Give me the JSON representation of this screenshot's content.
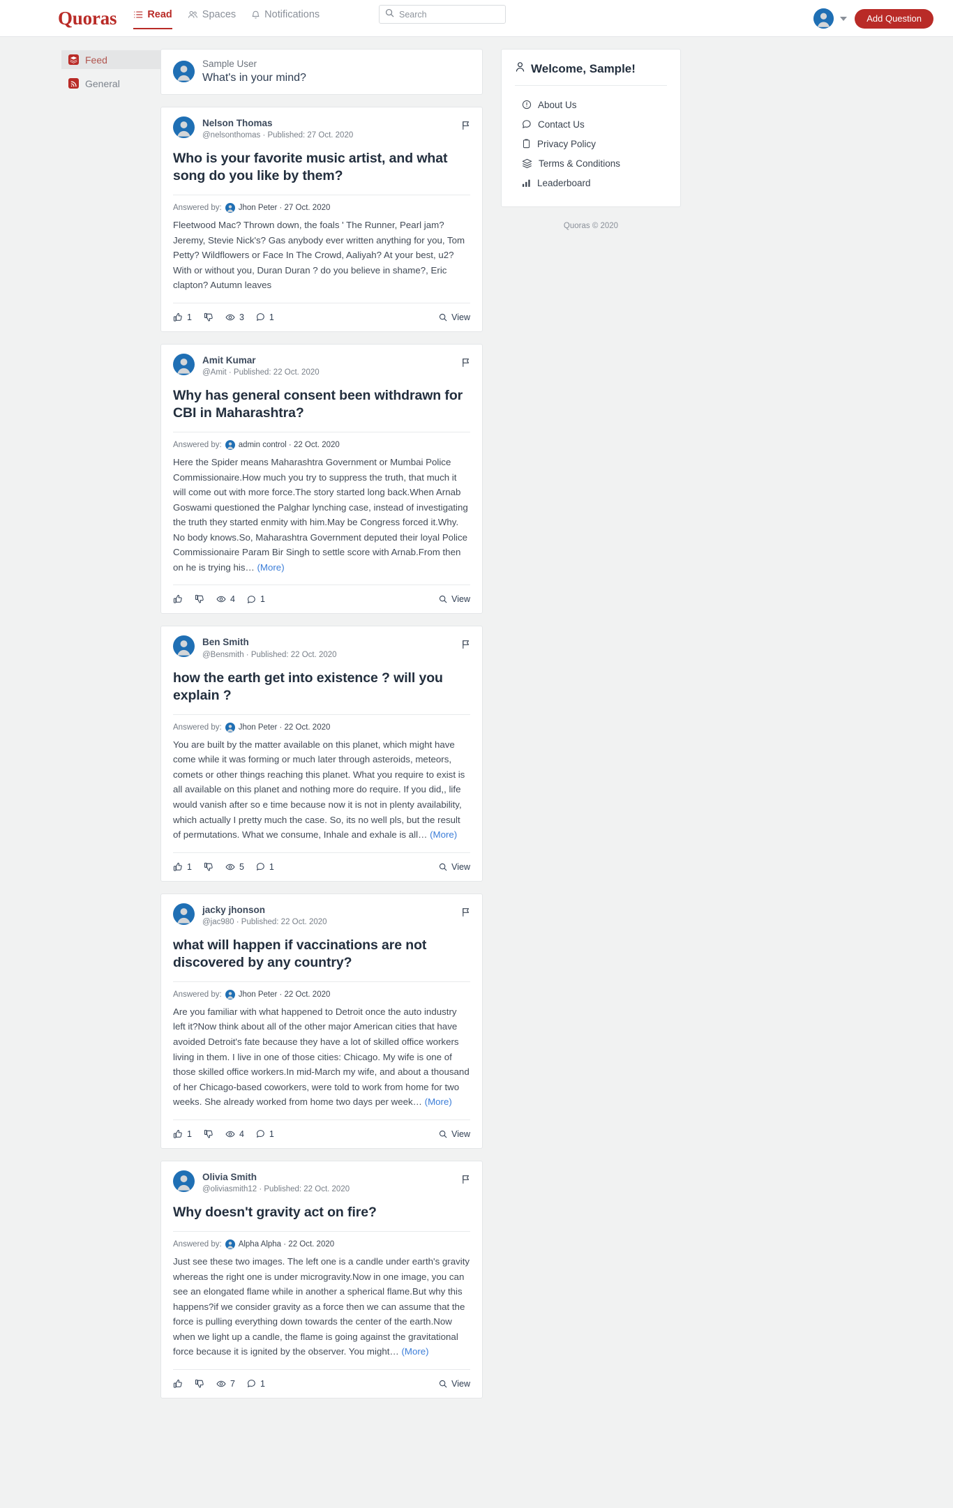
{
  "header": {
    "brand": "Quoras",
    "nav": [
      {
        "label": "Read",
        "icon": "list-icon",
        "active": true
      },
      {
        "label": "Spaces",
        "icon": "people-icon",
        "active": false
      },
      {
        "label": "Notifications",
        "icon": "bell-icon",
        "active": false
      }
    ],
    "search_placeholder": "Search",
    "search_value": "",
    "add_question_label": "Add Question",
    "accent_color": "#b92b27",
    "avatar_color": "#1f6fb4"
  },
  "sidebar": {
    "items": [
      {
        "label": "Feed",
        "icon": "layers-icon",
        "active": true
      },
      {
        "label": "General",
        "icon": "rss-icon",
        "active": false
      }
    ]
  },
  "composer": {
    "user": "Sample User",
    "prompt": "What's in your mind?"
  },
  "posts": [
    {
      "author": "Nelson Thomas",
      "handle": "@nelsonthomas",
      "published": "Published: 27 Oct. 2020",
      "title": "Who is your favorite music artist, and what song do you like by them?",
      "answered_by_label": "Answered by:",
      "answerer": "Jhon Peter",
      "answer_date": "27 Oct. 2020",
      "answer_text": "Fleetwood Mac? Thrown down, the foals ' The Runner, Pearl jam? Jeremy, Stevie Nick's? Gas anybody ever written anything for you, Tom Petty? Wildflowers or Face In The Crowd, Aaliyah? At your best, u2? With or without you, Duran Duran ? do you believe in shame?, Eric clapton? Autumn leaves",
      "more": "",
      "likes": "1",
      "dislikes": "",
      "views": "3",
      "comments": "1",
      "view_label": "View"
    },
    {
      "author": "Amit Kumar",
      "handle": "@Amit",
      "published": "Published: 22 Oct. 2020",
      "title": "Why has general consent been withdrawn for CBI in Maharashtra?",
      "answered_by_label": "Answered by:",
      "answerer": "admin control",
      "answer_date": "22 Oct. 2020",
      "answer_text": "Here the Spider means Maharashtra Government or Mumbai Police Commissionaire.How much you try to suppress the truth, that much it will come out with more force.The story started long back.When Arnab Goswami questioned the Palghar lynching case, instead of investigating the truth they started enmity with him.May be Congress forced it.Why. No body knows.So, Maharashtra Government deputed their loyal Police Commissionaire Param Bir Singh to settle score with Arnab.From then on he is trying his…",
      "more": "(More)",
      "likes": "",
      "dislikes": "",
      "views": "4",
      "comments": "1",
      "view_label": "View"
    },
    {
      "author": "Ben Smith",
      "handle": "@Bensmith",
      "published": "Published: 22 Oct. 2020",
      "title": "how the earth get into existence ? will you explain ?",
      "answered_by_label": "Answered by:",
      "answerer": "Jhon Peter",
      "answer_date": "22 Oct. 2020",
      "answer_text": "You are built by the matter available on this planet, which might have come while it was forming or much later through asteroids, meteors, comets or other things reaching this planet. What you require to exist is all available on this planet and nothing more do require. If you did,, life would vanish after so e time because now it is not in plenty availability, which actually I pretty much the case. So, its no well pls, but the result of permutations. What we consume, Inhale and exhale is all…",
      "more": "(More)",
      "likes": "1",
      "dislikes": "",
      "views": "5",
      "comments": "1",
      "view_label": "View"
    },
    {
      "author": "jacky jhonson",
      "handle": "@jac980",
      "published": "Published: 22 Oct. 2020",
      "title": "what will happen if vaccinations are not discovered by any country?",
      "answered_by_label": "Answered by:",
      "answerer": "Jhon Peter",
      "answer_date": "22 Oct. 2020",
      "answer_text": "Are you familiar with what happened to Detroit once the auto industry left it?Now think about all of the other major American cities that have avoided Detroit's fate because they have a lot of skilled office workers living in them. I live in one of those cities: Chicago. My wife is one of those skilled office workers.In mid-March my wife, and about a thousand of her Chicago-based coworkers, were told to work from home for two weeks. She already worked from home two days per week…",
      "more": "(More)",
      "likes": "1",
      "dislikes": "",
      "views": "4",
      "comments": "1",
      "view_label": "View"
    },
    {
      "author": "Olivia Smith",
      "handle": "@oliviasmith12",
      "published": "Published: 22 Oct. 2020",
      "title": "Why doesn't gravity act on fire?",
      "answered_by_label": "Answered by:",
      "answerer": "Alpha Alpha",
      "answer_date": "22 Oct. 2020",
      "answer_text": "Just see these two images. The left one is a candle under earth's gravity whereas the right one is under microgravity.Now in one image, you can see an elongated flame while in another a spherical flame.But why this happens?if we consider gravity as a force then we can assume that the force is pulling everything down towards the center of the earth.Now when we light up a candle, the flame is going against the gravitational force because it is ignited by the observer. You might…",
      "more": "(More)",
      "likes": "",
      "dislikes": "",
      "views": "7",
      "comments": "1",
      "view_label": "View"
    }
  ],
  "right_panel": {
    "title": "Welcome, Sample!",
    "items": [
      {
        "label": "About Us",
        "icon": "info-circle-icon"
      },
      {
        "label": "Contact Us",
        "icon": "chat-bubble-icon"
      },
      {
        "label": "Privacy Policy",
        "icon": "clipboard-icon"
      },
      {
        "label": "Terms & Conditions",
        "icon": "layers-icon"
      },
      {
        "label": "Leaderboard",
        "icon": "bar-chart-icon"
      }
    ],
    "footer": "Quoras © 2020"
  }
}
